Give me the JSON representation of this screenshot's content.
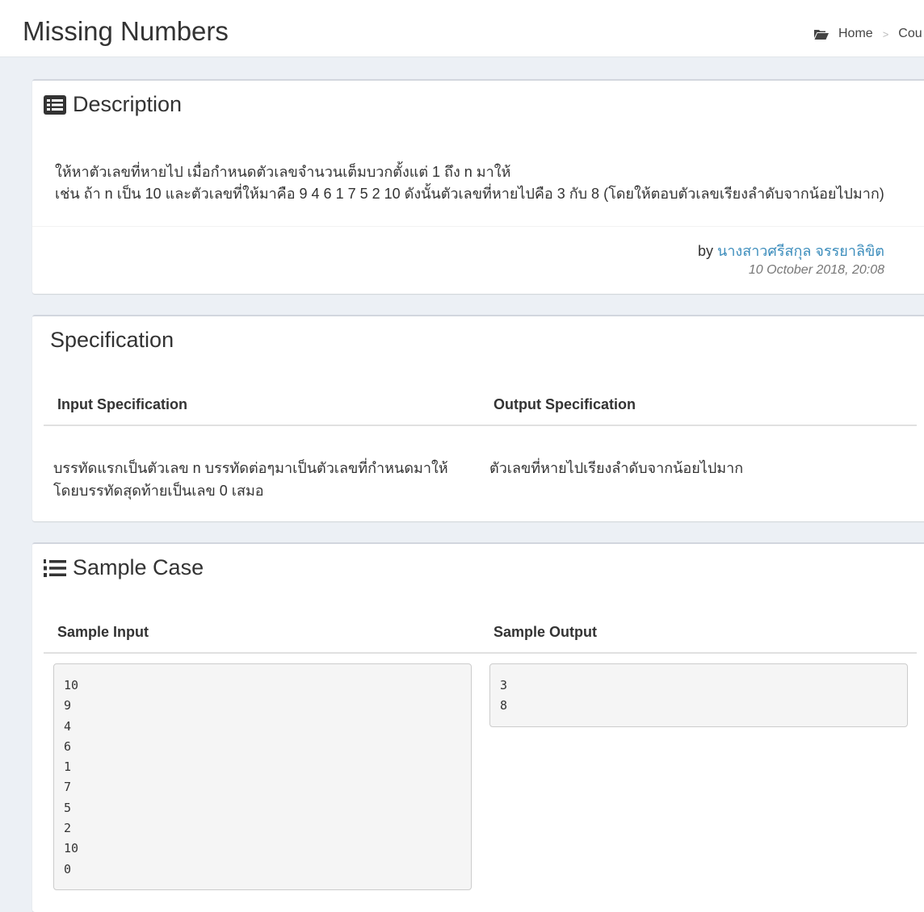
{
  "header": {
    "title": "Missing Numbers",
    "breadcrumb": [
      "Home",
      "Cou"
    ],
    "breadcrumb_separator": ">"
  },
  "description": {
    "title": "Description",
    "lines": [
      "ให้หาตัวเลขที่หายไป เมื่อกำหนดตัวเลขจำนวนเต็มบวกตั้งแต่ 1 ถึง n มาให้",
      "เช่น ถ้า n เป็น 10 และตัวเลขที่ให้มาคือ 9 4 6 1 7 5 2 10 ดังนั้นตัวเลขที่หายไปคือ 3 กับ 8 (โดยให้ตอบตัวเลขเรียงลำดับจากน้อยไปมาก)"
    ],
    "by_label": "by",
    "author": "นางสาวศรีสกุล จรรยาลิขิต",
    "posted": "10 October 2018, 20:08"
  },
  "specification": {
    "title": "Specification",
    "input_heading": "Input Specification",
    "output_heading": "Output Specification",
    "input_lines": [
      "บรรทัดแรกเป็นตัวเลข n บรรทัดต่อๆมาเป็นตัวเลขที่กำหนดมาให้",
      "โดยบรรทัดสุดท้ายเป็นเลข 0 เสมอ"
    ],
    "output_text": "ตัวเลขที่หายไปเรียงลำดับจากน้อยไปมาก"
  },
  "sample": {
    "title": "Sample Case",
    "input_heading": "Sample Input",
    "output_heading": "Sample Output",
    "input_lines": [
      "10",
      "9",
      "4",
      "6",
      "1",
      "7",
      "5",
      "2",
      "10",
      "0"
    ],
    "output_lines": [
      "3",
      "8"
    ]
  },
  "colors": {
    "link": "#3c8dbc",
    "background": "#ecf0f5"
  }
}
